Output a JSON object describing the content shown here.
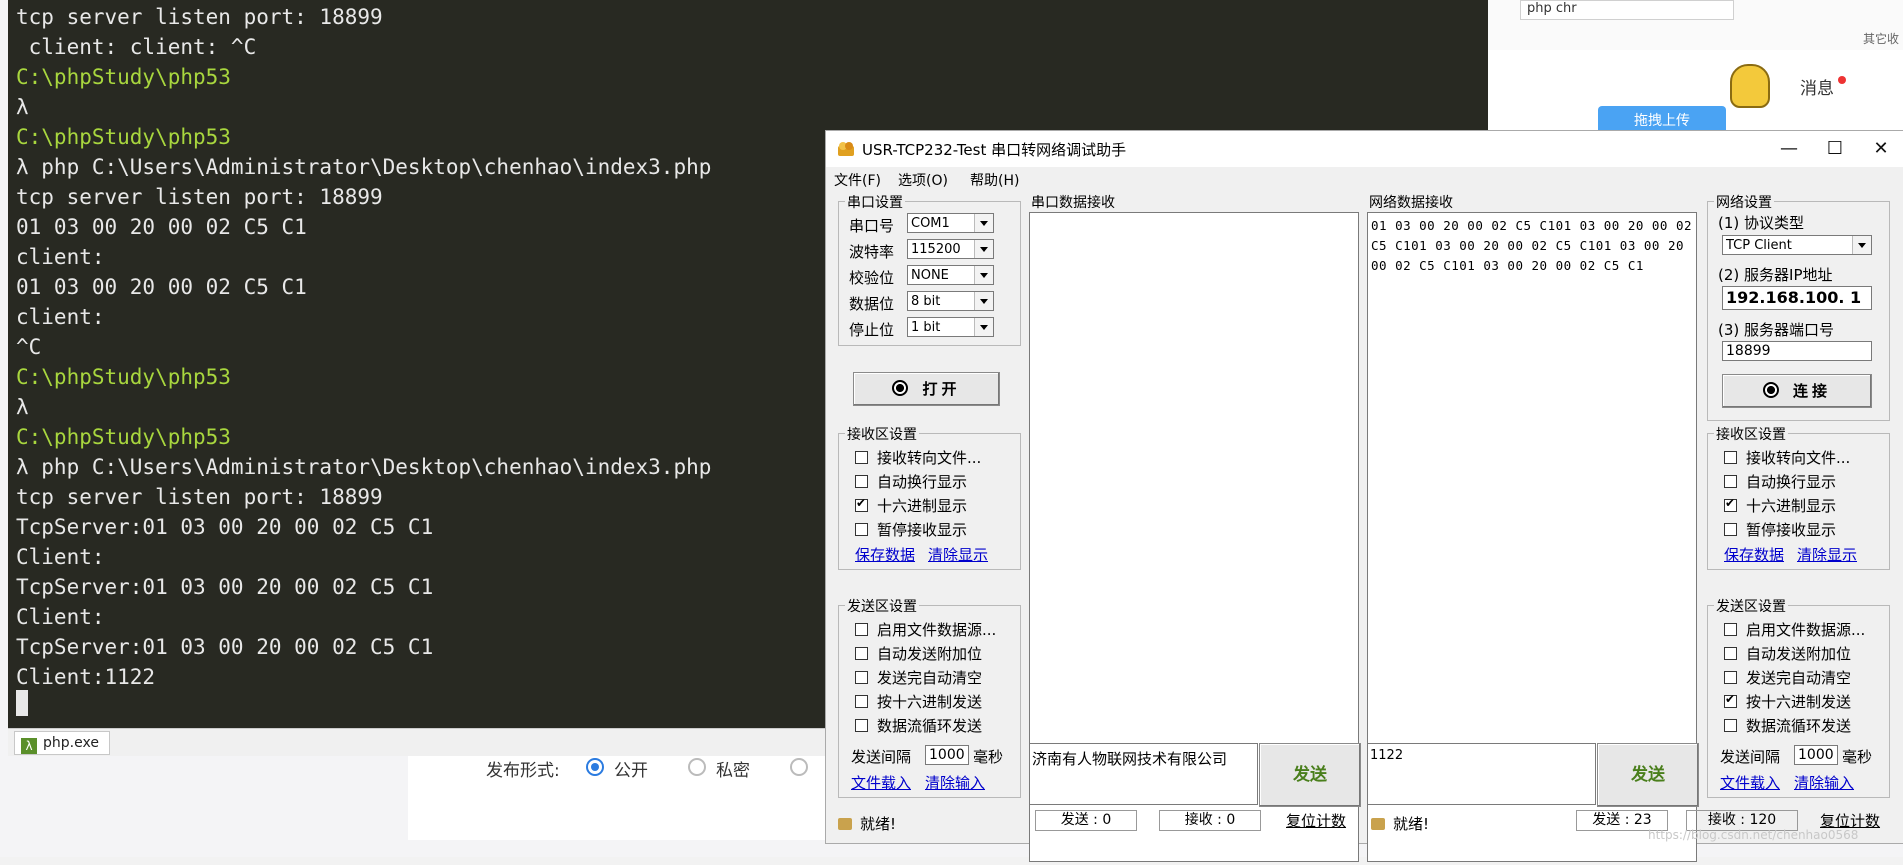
{
  "terminal": {
    "lines": [
      {
        "text": "tcp server listen port: 18899",
        "style": "w"
      },
      {
        "text": " client: client: ^C",
        "style": "w"
      },
      {
        "text": "C:\\phpStudy\\php53",
        "style": "g"
      },
      {
        "text": "λ",
        "style": "w"
      },
      {
        "text": "C:\\phpStudy\\php53",
        "style": "g"
      },
      {
        "text": "λ php C:\\Users\\Administrator\\Desktop\\chenhao\\index3.php",
        "style": "w"
      },
      {
        "text": "tcp server listen port: 18899",
        "style": "w"
      },
      {
        "text": "01 03 00 20 00 02 C5 C1",
        "style": "w"
      },
      {
        "text": "client:",
        "style": "w"
      },
      {
        "text": "01 03 00 20 00 02 C5 C1",
        "style": "w"
      },
      {
        "text": "client:",
        "style": "w"
      },
      {
        "text": "^C",
        "style": "w"
      },
      {
        "text": "C:\\phpStudy\\php53",
        "style": "g"
      },
      {
        "text": "λ",
        "style": "w"
      },
      {
        "text": "C:\\phpStudy\\php53",
        "style": "g"
      },
      {
        "text": "λ php C:\\Users\\Administrator\\Desktop\\chenhao\\index3.php",
        "style": "w"
      },
      {
        "text": "tcp server listen port: 18899",
        "style": "w"
      },
      {
        "text": "TcpServer:01 03 00 20 00 02 C5 C1",
        "style": "w"
      },
      {
        "text": "Client:",
        "style": "w"
      },
      {
        "text": "TcpServer:01 03 00 20 00 02 C5 C1",
        "style": "w"
      },
      {
        "text": "Client:",
        "style": "w"
      },
      {
        "text": "TcpServer:01 03 00 20 00 02 C5 C1",
        "style": "w"
      },
      {
        "text": "Client:1122",
        "style": "w"
      }
    ],
    "tab_label": "php.exe"
  },
  "browser": {
    "search_text": "php chr",
    "bookmark_other": "其它收",
    "message_label": "消息",
    "upload_label": "拖拽上传",
    "publish_label": "发布形式:",
    "option_public": "公开",
    "option_private": "私密"
  },
  "usr": {
    "title": "USR-TCP232-Test 串口转网络调试助手",
    "menu": [
      "文件(F)",
      "选项(O)",
      "帮助(H)"
    ],
    "serial": {
      "group_label": "串口设置",
      "port_label": "串口号",
      "port_value": "COM1",
      "baud_label": "波特率",
      "baud_value": "115200",
      "parity_label": "校验位",
      "parity_value": "NONE",
      "data_label": "数据位",
      "data_value": "8 bit",
      "stop_label": "停止位",
      "stop_value": "1 bit",
      "open_label": "打开"
    },
    "serial_recv": {
      "group_label": "接收区设置",
      "opt1": "接收转向文件...",
      "opt2": "自动换行显示",
      "opt3": "十六进制显示",
      "opt4": "暂停接收显示",
      "save": "保存数据",
      "clear": "清除显示"
    },
    "serial_send": {
      "group_label": "发送区设置",
      "opt1": "启用文件数据源...",
      "opt2": "自动发送附加位",
      "opt3": "发送完自动清空",
      "opt4": "按十六进制发送",
      "opt5": "数据流循环发送",
      "interval_label": "发送间隔",
      "interval_value": "1000",
      "interval_unit": "毫秒",
      "load": "文件载入",
      "clear": "清除输入"
    },
    "serial_data": {
      "label": "串口数据接收",
      "send_text": "济南有人物联网技术有限公司",
      "send_button": "发送",
      "status": "就绪!",
      "sent": "发送 : 0",
      "received": "接收 : 0",
      "reset": "复位计数"
    },
    "net_data": {
      "label": "网络数据接收",
      "received_text": "01 03 00 20 00 02 C5 C101 03 00 20 00 02 C5 C101 03 00 20 00 02 C5 C101 03 00 20 00 02 C5 C101 03 00 20 00 02 C5 C1",
      "send_text": "1122",
      "send_button": "发送",
      "status": "就绪!",
      "sent": "发送 : 23",
      "received": "接收 : 120",
      "reset": "复位计数"
    },
    "net": {
      "group_label": "网络设置",
      "protocol_label": "(1) 协议类型",
      "protocol_value": "TCP Client",
      "ip_label": "(2) 服务器IP地址",
      "ip_value": "192.168.100. 1",
      "port_label": "(3) 服务器端口号",
      "port_value": "18899",
      "connect_label": "连接"
    },
    "net_recv": {
      "group_label": "接收区设置",
      "opt1": "接收转向文件...",
      "opt2": "自动换行显示",
      "opt3": "十六进制显示",
      "opt4": "暂停接收显示",
      "save": "保存数据",
      "clear": "清除显示"
    },
    "net_send": {
      "group_label": "发送区设置",
      "opt1": "启用文件数据源...",
      "opt2": "自动发送附加位",
      "opt3": "发送完自动清空",
      "opt4": "按十六进制发送",
      "opt5": "数据流循环发送",
      "interval_label": "发送间隔",
      "interval_value": "1000",
      "interval_unit": "毫秒",
      "load": "文件载入",
      "clear": "清除输入"
    }
  },
  "watermark": "https://blog.csdn.net/chenhao0568"
}
